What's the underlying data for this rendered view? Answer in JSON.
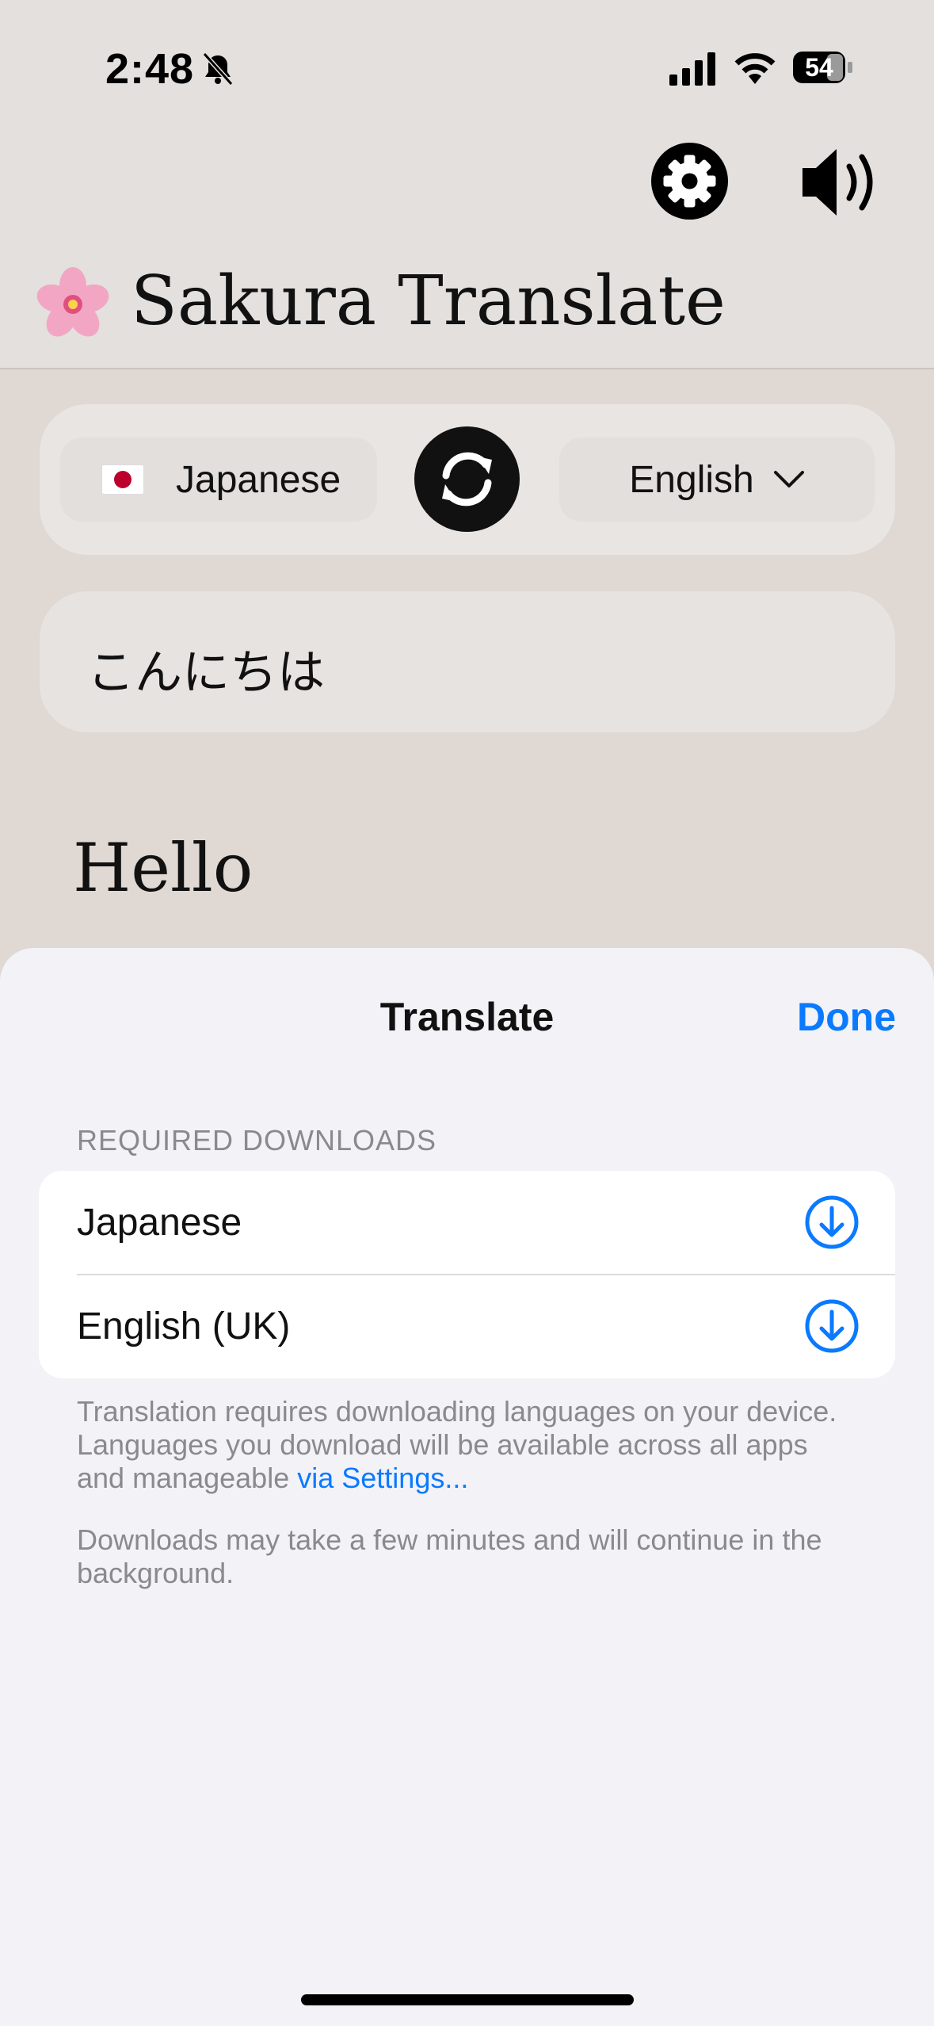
{
  "status_bar": {
    "time": "2:48",
    "battery": "54"
  },
  "app": {
    "title": "Sakura Translate"
  },
  "language_bar": {
    "from": "Japanese",
    "to": "English"
  },
  "input": {
    "text": "こんにちは"
  },
  "output": {
    "text": "Hello"
  },
  "sheet": {
    "title": "Translate",
    "done_label": "Done",
    "section_header": "REQUIRED DOWNLOADS",
    "items": [
      {
        "label": "Japanese"
      },
      {
        "label": "English (UK)"
      }
    ],
    "footnote_1": "Translation requires downloading languages on your device. Languages you download will be available across all apps and manageable ",
    "footnote_1_link": "via Settings...",
    "footnote_2": "Downloads may take a few minutes and will continue in the background."
  },
  "colors": {
    "accent": "#0a7aff",
    "header_bg": "#e3e0de",
    "sheet_bg": "#f2f2f7"
  }
}
